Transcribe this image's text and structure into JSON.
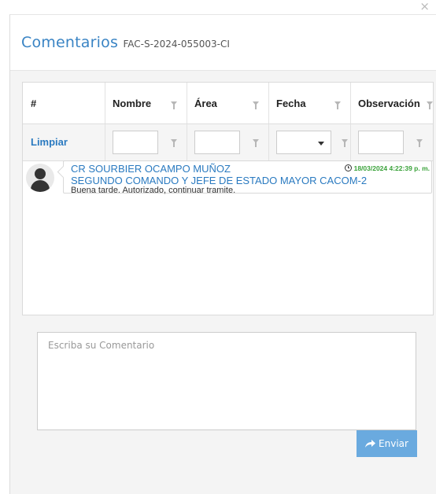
{
  "window": {
    "close_glyph": "×"
  },
  "header": {
    "title": "Comentarios",
    "code": "FAC-S-2024-055003-CI"
  },
  "grid": {
    "columns": [
      "#",
      "Nombre",
      "Área",
      "Fecha",
      "Observación"
    ],
    "filter": {
      "clear_label": "Limpiar"
    }
  },
  "comments": [
    {
      "author": "CR SOURBIER OCAMPO MUÑOZ",
      "position": "SEGUNDO COMANDO Y JEFE DE ESTADO MAYOR CACOM-2",
      "text": "Buena tarde. Autorizado, continuar tramite.",
      "date": "18/03/2024 4:22:39 p. m."
    }
  ],
  "composer": {
    "placeholder": "Escriba su Comentario",
    "send_label": "Enviar"
  },
  "icons": [
    "close-icon",
    "filter-icon",
    "chevron-down-icon",
    "avatar-icon",
    "clock-icon",
    "reply-arrow-icon"
  ],
  "colors": {
    "title": "#3a84c4",
    "link": "#2a7ac0",
    "date": "#3aa23a",
    "button": "#6aaadf"
  }
}
